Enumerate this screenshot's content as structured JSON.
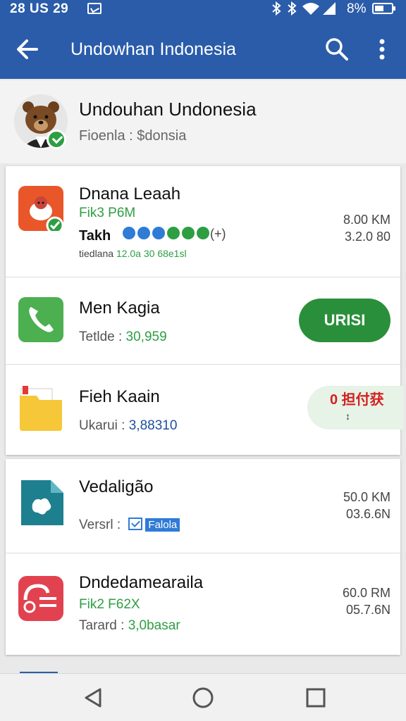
{
  "status_bar": {
    "time": "28 US 29",
    "battery": "8%",
    "icons": [
      "notification-icon",
      "bluetooth-icon",
      "vibrate-icon",
      "wifi-icon",
      "signal-icon",
      "battery-icon"
    ]
  },
  "app_bar": {
    "title": "Undowhan Indonesia",
    "icons": [
      "back-arrow-icon",
      "search-icon",
      "more-vert-icon"
    ]
  },
  "profile": {
    "name": "Undouhan Undonesia",
    "subtitle": "Fioenla : $donsia"
  },
  "apps": [
    {
      "title": "Dnana Leaah",
      "line2": "Fik3 P6M",
      "tarikh_label": "Takh",
      "tarikh_extra": "(+)",
      "meta_label": "tiedlana",
      "meta_value": "12.0a 30 68e1sl",
      "size_top": "8.00 KM",
      "size_bottom": "3.2.0 80",
      "icon": "bear-app-icon"
    },
    {
      "title": "Men Kagia",
      "line2_label": "Tetlde : ",
      "line2_value": "30,959",
      "button": "URISI",
      "icon": "phone-icon"
    },
    {
      "title": "Fieh Kaain",
      "line2_label": "Ukarui : ",
      "line2_value": "3,88310",
      "button": "0 担付获",
      "button_sub": "↕",
      "icon": "folder-icon"
    },
    {
      "title": "Vedaligão",
      "line2_label": "Versrl : ",
      "tag": "Falola",
      "size_top": "50.0 KM",
      "size_bottom": "03.6.6N",
      "icon": "document-icon"
    },
    {
      "title": "Dndedamearaila",
      "line2": "Fik2 F62X",
      "line3_label": "Tarard : ",
      "line3_value": "3,0basar",
      "size_top": "60.0 RM",
      "size_bottom": "05.7.6N",
      "icon": "lock-card-icon"
    }
  ],
  "nav": {
    "icons": [
      "back-triangle-icon",
      "home-circle-icon",
      "recents-square-icon"
    ]
  },
  "colors": {
    "app_bar": "#2a5caa",
    "green": "#2e9e43",
    "button_green": "#2a8f3a",
    "red": "#d32020"
  }
}
